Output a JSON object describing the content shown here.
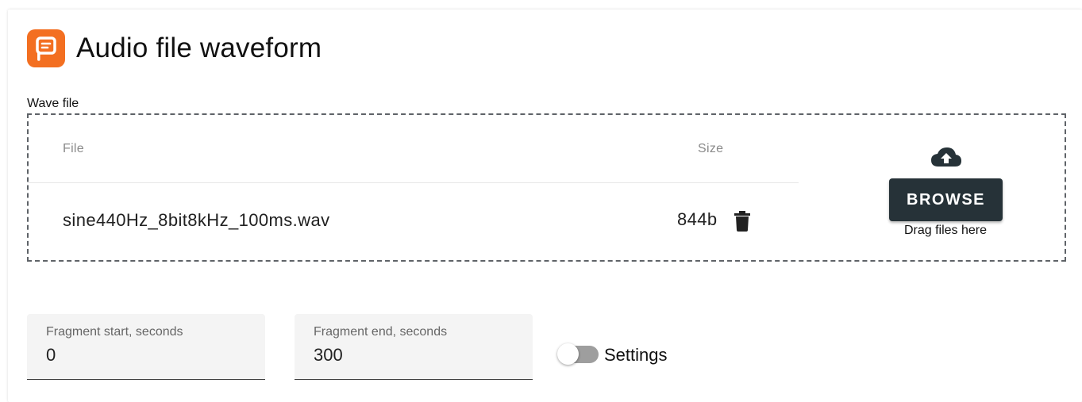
{
  "app": {
    "title": "Audio file waveform",
    "logo_icon": "presentation-logo-icon",
    "logo_color": "#f36f21"
  },
  "wave_file": {
    "label": "Wave file",
    "columns": {
      "file": "File",
      "size": "Size"
    },
    "files": [
      {
        "name": "sine440Hz_8bit8kHz_100ms.wav",
        "size": "844b",
        "delete_icon": "trash-icon"
      }
    ],
    "upload_icon": "cloud-upload-icon",
    "browse_label": "BROWSE",
    "drag_text": "Drag files here",
    "browse_color": "#263238"
  },
  "fragment": {
    "start_label": "Fragment start, seconds",
    "start_value": "0",
    "end_label": "Fragment end, seconds",
    "end_value": "300"
  },
  "settings_toggle": {
    "label": "Settings",
    "checked": false
  }
}
